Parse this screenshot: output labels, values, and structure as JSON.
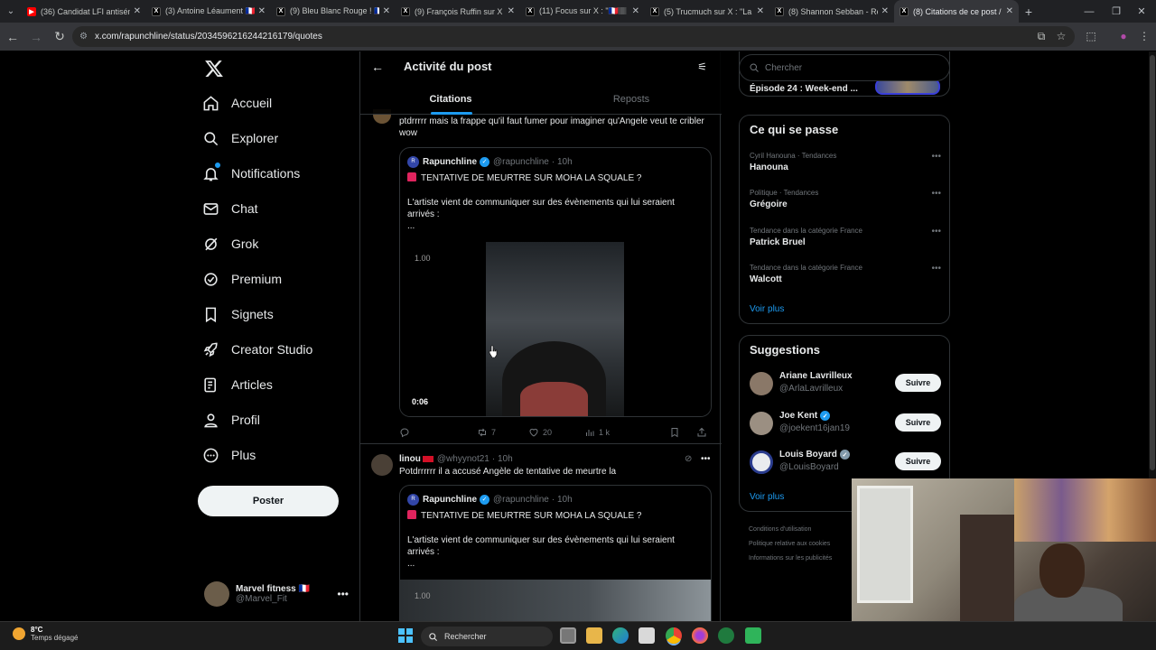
{
  "browser": {
    "tabs": [
      {
        "title": "(36) Candidat LFI antisém",
        "favicon": "youtube",
        "active": false
      },
      {
        "title": "(3) Antoine Léaument 🇫🇷",
        "favicon": "x",
        "active": false
      },
      {
        "title": "(9) Bleu Blanc Rouge ! 🇫🇷",
        "favicon": "x",
        "active": false
      },
      {
        "title": "(9) François Ruffin sur X :",
        "favicon": "x",
        "active": false
      },
      {
        "title": "(11) Focus sur X : \"🇫🇷🏽 B",
        "favicon": "x",
        "active": false
      },
      {
        "title": "(5) Trucmuch sur X : \"La c",
        "favicon": "x",
        "active": false
      },
      {
        "title": "(8) Shannon Sebban - Re",
        "favicon": "x",
        "active": false
      },
      {
        "title": "(8) Citations de ce post /",
        "favicon": "x",
        "active": true
      }
    ],
    "url": "x.com/rapunchline/status/2034596216244216179/quotes"
  },
  "nav": {
    "items": [
      {
        "label": "Accueil",
        "icon": "home-icon"
      },
      {
        "label": "Explorer",
        "icon": "search-icon"
      },
      {
        "label": "Notifications",
        "icon": "bell-icon"
      },
      {
        "label": "Chat",
        "icon": "mail-icon"
      },
      {
        "label": "Grok",
        "icon": "grok-icon"
      },
      {
        "label": "Premium",
        "icon": "premium-icon"
      },
      {
        "label": "Signets",
        "icon": "bookmark-icon"
      },
      {
        "label": "Creator Studio",
        "icon": "rocket-icon"
      },
      {
        "label": "Articles",
        "icon": "article-icon"
      },
      {
        "label": "Profil",
        "icon": "person-icon"
      },
      {
        "label": "Plus",
        "icon": "more-circle-icon"
      }
    ],
    "post_button": "Poster",
    "account": {
      "name": "Marvel fitness 🇫🇷",
      "handle": "@Marvel_Fit"
    }
  },
  "center": {
    "header_title": "Activité du post",
    "tabs": [
      "Citations",
      "Reposts"
    ],
    "posts": [
      {
        "text": "ptdrrrrr mais la frappe qu'il faut fumer pour imaginer qu'Angele veut te cribler wow",
        "quote": {
          "name": "Rapunchline",
          "handle": "@rapunchline",
          "time": "· 10h",
          "line1": "TENTATIVE DE MEURTRE SUR MOHA LA SQUALE ?",
          "line2": "L'artiste vient de communiquer sur des évènements qui lui seraient arrivés :",
          "line3": "...",
          "video_rate": "1.00",
          "video_time": "0:06"
        },
        "stats": {
          "replies": "",
          "reposts": "7",
          "likes": "20",
          "views": "1 k"
        }
      },
      {
        "author": "linou",
        "handle": "@whyynot21",
        "time": "· 10h",
        "text": "Potdrrrrrr il a accusé Angèle de tentative de meurtre la",
        "quote": {
          "name": "Rapunchline",
          "handle": "@rapunchline",
          "time": "· 10h",
          "line1": "TENTATIVE DE MEURTRE SUR MOHA LA SQUALE ?",
          "line2": "L'artiste vient de communiquer sur des évènements qui lui seraient arrivés :",
          "line3": "...",
          "video_rate": "1.00"
        }
      }
    ]
  },
  "right": {
    "search_placeholder": "Chercher",
    "episode": "Épisode 24 : Week-end ...",
    "trends_title": "Ce qui se passe",
    "trends": [
      {
        "context": "Cyril Hanouna · Tendances",
        "name": "Hanouna"
      },
      {
        "context": "Politique · Tendances",
        "name": "Grégoire"
      },
      {
        "context": "Tendance dans la catégorie France",
        "name": "Patrick Bruel"
      },
      {
        "context": "Tendance dans la catégorie France",
        "name": "Walcott"
      }
    ],
    "trends_more": "Voir plus",
    "suggestions_title": "Suggestions",
    "suggestions": [
      {
        "name": "Ariane Lavrilleux",
        "handle": "@ArlaLavrilleux",
        "verified": false,
        "button": "Suivre"
      },
      {
        "name": "Joe Kent",
        "handle": "@joekent16jan19",
        "verified": true,
        "button": "Suivre"
      },
      {
        "name": "Louis Boyard",
        "handle": "@LouisBoyard",
        "verified": true,
        "button": "Suivre"
      }
    ],
    "suggestions_more": "Voir plus",
    "footer": [
      "Conditions d'utilisation",
      "Politique relative aux cookies",
      "Informations sur les publicités"
    ]
  },
  "taskbar": {
    "temperature": "8°C",
    "weather": "Temps dégagé",
    "search": "Rechercher"
  },
  "colors": {
    "accent": "#1d9bf0",
    "background": "#000000",
    "border": "#2f3336",
    "muted": "#71767b"
  }
}
